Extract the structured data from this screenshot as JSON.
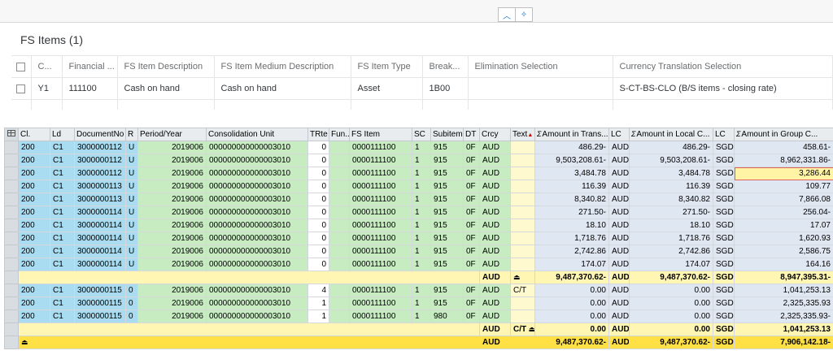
{
  "top": {
    "title": "FS Items (1)",
    "collapse_icon": "chevron-up-icon",
    "pin_icon": "pin-icon",
    "columns": [
      "C...",
      "Financial ...",
      "FS Item Description",
      "FS Item Medium Description",
      "FS Item Type",
      "Break...",
      "Elimination Selection",
      "Currency Translation Selection"
    ],
    "row": [
      "Y1",
      "111100",
      "Cash on hand",
      "Cash on hand",
      "Asset",
      "1B00",
      "",
      "S-CT-BS-CLO (B/S items - closing rate)"
    ]
  },
  "grid": {
    "headers": {
      "cl": "Cl.",
      "ld": "Ld",
      "docno": "DocumentNo",
      "r": "R",
      "period": "Period/Year",
      "cu": "Consolidation Unit",
      "trte": "TRte",
      "fun": "Fun...",
      "fsitem": "FS Item",
      "sc": "SC",
      "subitem": "Subitem",
      "dt": "DT",
      "crcy": "Crcy",
      "text": "Text",
      "amt_trans": "Amount in Trans...",
      "lc1": "LC",
      "amt_local": "Amount in Local C...",
      "lc2": "LC",
      "amt_group": "Amount in Group C..."
    },
    "rows": [
      {
        "cl": "200",
        "ld": "C1",
        "docno": "3000000112",
        "r": "U",
        "period": "2019006",
        "cu": "000000000000003010",
        "trte": "0",
        "fun": "",
        "fsitem": "0000111100",
        "sc": "1",
        "subitem": "915",
        "dt": "0F",
        "crcy": "AUD",
        "text": "",
        "amt_trans": "486.29-",
        "lc1": "AUD",
        "amt_local": "486.29-",
        "lc2": "SGD",
        "amt_group": "458.61-"
      },
      {
        "cl": "200",
        "ld": "C1",
        "docno": "3000000112",
        "r": "U",
        "period": "2019006",
        "cu": "000000000000003010",
        "trte": "0",
        "fun": "",
        "fsitem": "0000111100",
        "sc": "1",
        "subitem": "915",
        "dt": "0F",
        "crcy": "AUD",
        "text": "",
        "amt_trans": "9,503,208.61-",
        "lc1": "AUD",
        "amt_local": "9,503,208.61-",
        "lc2": "SGD",
        "amt_group": "8,962,331.86-"
      },
      {
        "cl": "200",
        "ld": "C1",
        "docno": "3000000112",
        "r": "U",
        "period": "2019006",
        "cu": "000000000000003010",
        "trte": "0",
        "fun": "",
        "fsitem": "0000111100",
        "sc": "1",
        "subitem": "915",
        "dt": "0F",
        "crcy": "AUD",
        "text": "",
        "amt_trans": "3,484.78",
        "lc1": "AUD",
        "amt_local": "3,484.78",
        "lc2": "SGD",
        "amt_group": "3,286.44"
      },
      {
        "cl": "200",
        "ld": "C1",
        "docno": "3000000113",
        "r": "U",
        "period": "2019006",
        "cu": "000000000000003010",
        "trte": "0",
        "fun": "",
        "fsitem": "0000111100",
        "sc": "1",
        "subitem": "915",
        "dt": "0F",
        "crcy": "AUD",
        "text": "",
        "amt_trans": "116.39",
        "lc1": "AUD",
        "amt_local": "116.39",
        "lc2": "SGD",
        "amt_group": "109.77"
      },
      {
        "cl": "200",
        "ld": "C1",
        "docno": "3000000113",
        "r": "U",
        "period": "2019006",
        "cu": "000000000000003010",
        "trte": "0",
        "fun": "",
        "fsitem": "0000111100",
        "sc": "1",
        "subitem": "915",
        "dt": "0F",
        "crcy": "AUD",
        "text": "",
        "amt_trans": "8,340.82",
        "lc1": "AUD",
        "amt_local": "8,340.82",
        "lc2": "SGD",
        "amt_group": "7,866.08"
      },
      {
        "cl": "200",
        "ld": "C1",
        "docno": "3000000114",
        "r": "U",
        "period": "2019006",
        "cu": "000000000000003010",
        "trte": "0",
        "fun": "",
        "fsitem": "0000111100",
        "sc": "1",
        "subitem": "915",
        "dt": "0F",
        "crcy": "AUD",
        "text": "",
        "amt_trans": "271.50-",
        "lc1": "AUD",
        "amt_local": "271.50-",
        "lc2": "SGD",
        "amt_group": "256.04-"
      },
      {
        "cl": "200",
        "ld": "C1",
        "docno": "3000000114",
        "r": "U",
        "period": "2019006",
        "cu": "000000000000003010",
        "trte": "0",
        "fun": "",
        "fsitem": "0000111100",
        "sc": "1",
        "subitem": "915",
        "dt": "0F",
        "crcy": "AUD",
        "text": "",
        "amt_trans": "18.10",
        "lc1": "AUD",
        "amt_local": "18.10",
        "lc2": "SGD",
        "amt_group": "17.07"
      },
      {
        "cl": "200",
        "ld": "C1",
        "docno": "3000000114",
        "r": "U",
        "period": "2019006",
        "cu": "000000000000003010",
        "trte": "0",
        "fun": "",
        "fsitem": "0000111100",
        "sc": "1",
        "subitem": "915",
        "dt": "0F",
        "crcy": "AUD",
        "text": "",
        "amt_trans": "1,718.76",
        "lc1": "AUD",
        "amt_local": "1,718.76",
        "lc2": "SGD",
        "amt_group": "1,620.93"
      },
      {
        "cl": "200",
        "ld": "C1",
        "docno": "3000000114",
        "r": "U",
        "period": "2019006",
        "cu": "000000000000003010",
        "trte": "0",
        "fun": "",
        "fsitem": "0000111100",
        "sc": "1",
        "subitem": "915",
        "dt": "0F",
        "crcy": "AUD",
        "text": "",
        "amt_trans": "2,742.86",
        "lc1": "AUD",
        "amt_local": "2,742.86",
        "lc2": "SGD",
        "amt_group": "2,586.75"
      },
      {
        "cl": "200",
        "ld": "C1",
        "docno": "3000000114",
        "r": "U",
        "period": "2019006",
        "cu": "000000000000003010",
        "trte": "0",
        "fun": "",
        "fsitem": "0000111100",
        "sc": "1",
        "subitem": "915",
        "dt": "0F",
        "crcy": "AUD",
        "text": "",
        "amt_trans": "174.07",
        "lc1": "AUD",
        "amt_local": "174.07",
        "lc2": "SGD",
        "amt_group": "164.16"
      }
    ],
    "subtotal1": {
      "crcy": "AUD",
      "amt_trans": "9,487,370.62-",
      "lc1": "AUD",
      "amt_local": "9,487,370.62-",
      "lc2": "SGD",
      "amt_group": "8,947,395.31-"
    },
    "rows2": [
      {
        "cl": "200",
        "ld": "C1",
        "docno": "3000000115",
        "r": "0",
        "period": "2019006",
        "cu": "000000000000003010",
        "trte": "4",
        "fun": "",
        "fsitem": "0000111100",
        "sc": "1",
        "subitem": "915",
        "dt": "0F",
        "crcy": "AUD",
        "text": "C/T",
        "amt_trans": "0.00",
        "lc1": "AUD",
        "amt_local": "0.00",
        "lc2": "SGD",
        "amt_group": "1,041,253.13"
      },
      {
        "cl": "200",
        "ld": "C1",
        "docno": "3000000115",
        "r": "0",
        "period": "2019006",
        "cu": "000000000000003010",
        "trte": "1",
        "fun": "",
        "fsitem": "0000111100",
        "sc": "1",
        "subitem": "915",
        "dt": "0F",
        "crcy": "AUD",
        "text": "",
        "amt_trans": "0.00",
        "lc1": "AUD",
        "amt_local": "0.00",
        "lc2": "SGD",
        "amt_group": "2,325,335.93"
      },
      {
        "cl": "200",
        "ld": "C1",
        "docno": "3000000115",
        "r": "0",
        "period": "2019006",
        "cu": "000000000000003010",
        "trte": "1",
        "fun": "",
        "fsitem": "0000111100",
        "sc": "1",
        "subitem": "980",
        "dt": "0F",
        "crcy": "AUD",
        "text": "",
        "amt_trans": "0.00",
        "lc1": "AUD",
        "amt_local": "0.00",
        "lc2": "SGD",
        "amt_group": "2,325,335.93-"
      }
    ],
    "subtotal2": {
      "crcy": "AUD",
      "text": "C/T",
      "amt_trans": "0.00",
      "lc1": "AUD",
      "amt_local": "0.00",
      "lc2": "SGD",
      "amt_group": "1,041,253.13"
    },
    "total": {
      "crcy": "AUD",
      "amt_trans": "9,487,370.62-",
      "lc1": "AUD",
      "amt_local": "9,487,370.62-",
      "lc2": "SGD",
      "amt_group": "7,906,142.18-"
    },
    "sum_icon": "subtotal-icon",
    "layout_icon": "layout-icon"
  }
}
